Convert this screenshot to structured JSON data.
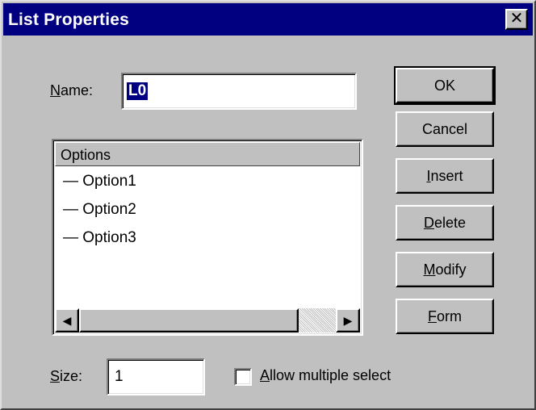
{
  "window": {
    "title": "List Properties",
    "close_symbol": "✕"
  },
  "name": {
    "label_mnemonic": "N",
    "label_rest": "ame:",
    "value": "L0"
  },
  "options_list": {
    "header": "Options",
    "items": [
      "— Option1",
      "— Option2",
      "— Option3"
    ]
  },
  "scrollbar": {
    "left_arrow": "◀",
    "right_arrow": "▶"
  },
  "buttons": {
    "ok": {
      "label": "OK"
    },
    "cancel": {
      "label": "Cancel"
    },
    "insert": {
      "mnemonic": "I",
      "rest": "nsert"
    },
    "delete": {
      "mnemonic": "D",
      "rest": "elete"
    },
    "modify": {
      "mnemonic": "M",
      "rest": "odify"
    },
    "form": {
      "mnemonic": "F",
      "rest": "orm"
    }
  },
  "size": {
    "label_mnemonic": "S",
    "label_rest": "ize:",
    "value": "1"
  },
  "multiple_select": {
    "label_mnemonic": "A",
    "label_rest": "llow multiple select",
    "checked": false
  }
}
